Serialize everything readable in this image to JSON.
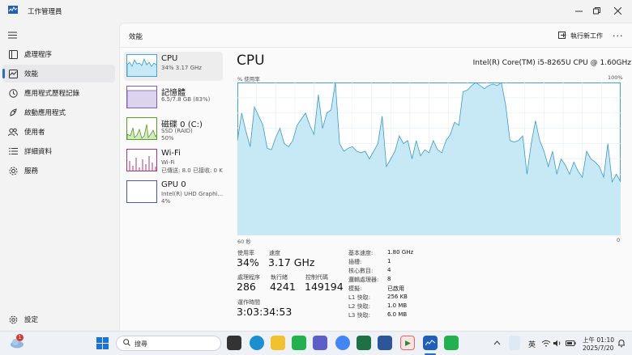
{
  "window": {
    "title": "工作管理員"
  },
  "sidebar": {
    "items": [
      {
        "label": "處理程序",
        "icon": "processes-icon"
      },
      {
        "label": "效能",
        "icon": "performance-icon"
      },
      {
        "label": "應用程式歷程記錄",
        "icon": "app-history-icon"
      },
      {
        "label": "啟動應用程式",
        "icon": "startup-apps-icon"
      },
      {
        "label": "使用者",
        "icon": "users-icon"
      },
      {
        "label": "詳細資料",
        "icon": "details-icon"
      },
      {
        "label": "服務",
        "icon": "services-icon"
      }
    ],
    "settings_label": "設定"
  },
  "header": {
    "title": "效能",
    "run_task_label": "執行新工作",
    "more_label": "..."
  },
  "devices": [
    {
      "name": "CPU",
      "sub1": "34%  3.17 GHz",
      "sub2": ""
    },
    {
      "name": "記憶體",
      "sub1": "6.5/7.8 GB (83%)",
      "sub2": ""
    },
    {
      "name": "磁碟 0 (C:)",
      "sub1": "SSD (RAID)",
      "sub2": "50%"
    },
    {
      "name": "Wi-Fi",
      "sub1": "Wi-Fi",
      "sub2": "已傳送: 8.0  已接收: 0 K"
    },
    {
      "name": "GPU 0",
      "sub1": "Intel(R) UHD Graphi...",
      "sub2": "4%"
    }
  ],
  "cpu": {
    "title": "CPU",
    "model": "Intel(R) Core(TM) i5-8265U CPU @ 1.60GHz",
    "axis_top_left": "% 使用率",
    "axis_top_right": "100%",
    "axis_bottom_left": "60 秒",
    "axis_bottom_right": "0",
    "stats": {
      "utilization_label": "使用率",
      "utilization": "34%",
      "speed_label": "速度",
      "speed": "3.17 GHz",
      "processes_label": "處理程序",
      "processes": "286",
      "threads_label": "執行緒",
      "threads": "4241",
      "handles_label": "控制代碼",
      "handles": "149194",
      "uptime_label": "運作時間",
      "uptime": "3:03:34:53"
    },
    "specs": [
      {
        "label": "基本速度:",
        "value": "1.80 GHz"
      },
      {
        "label": "插槽:",
        "value": "1"
      },
      {
        "label": "核心數目:",
        "value": "4"
      },
      {
        "label": "邏輯處理器:",
        "value": "8"
      },
      {
        "label": "模擬:",
        "value": "已啟用"
      },
      {
        "label": "L1 快取:",
        "value": "256 KB"
      },
      {
        "label": "L2 快取:",
        "value": "1.0 MB"
      },
      {
        "label": "L3 快取:",
        "value": "6.0 MB"
      }
    ]
  },
  "chart_data": {
    "type": "area",
    "ylim": [
      0,
      100
    ],
    "xlim": [
      60,
      0
    ],
    "values": [
      62,
      80,
      68,
      58,
      84,
      78,
      72,
      57,
      56,
      64,
      70,
      60,
      58,
      62,
      72,
      76,
      80,
      72,
      66,
      92,
      70,
      80,
      82,
      100,
      60,
      55,
      57,
      58,
      55,
      54,
      55,
      50,
      55,
      60,
      78,
      45,
      50,
      55,
      65,
      60,
      62,
      50,
      62,
      52,
      56,
      54,
      62,
      56,
      54,
      62,
      66,
      74,
      72,
      94,
      95,
      98,
      100,
      98,
      96,
      98,
      99,
      98,
      100,
      85,
      62,
      61,
      62,
      65,
      40,
      60,
      75,
      62,
      55,
      45,
      55,
      40,
      50,
      46,
      40,
      48,
      42,
      38,
      55,
      50,
      48,
      45,
      38,
      60,
      35,
      40,
      35
    ]
  },
  "taskbar": {
    "search_placeholder": "搜尋",
    "ime_label": "英",
    "time": "上午 01:10",
    "date": "2025/7/20",
    "notification_count": "1"
  },
  "colors": {
    "graph_fill": "#c7e8f5",
    "graph_line": "#3a9cc6",
    "accent": "#2a6bd1"
  }
}
